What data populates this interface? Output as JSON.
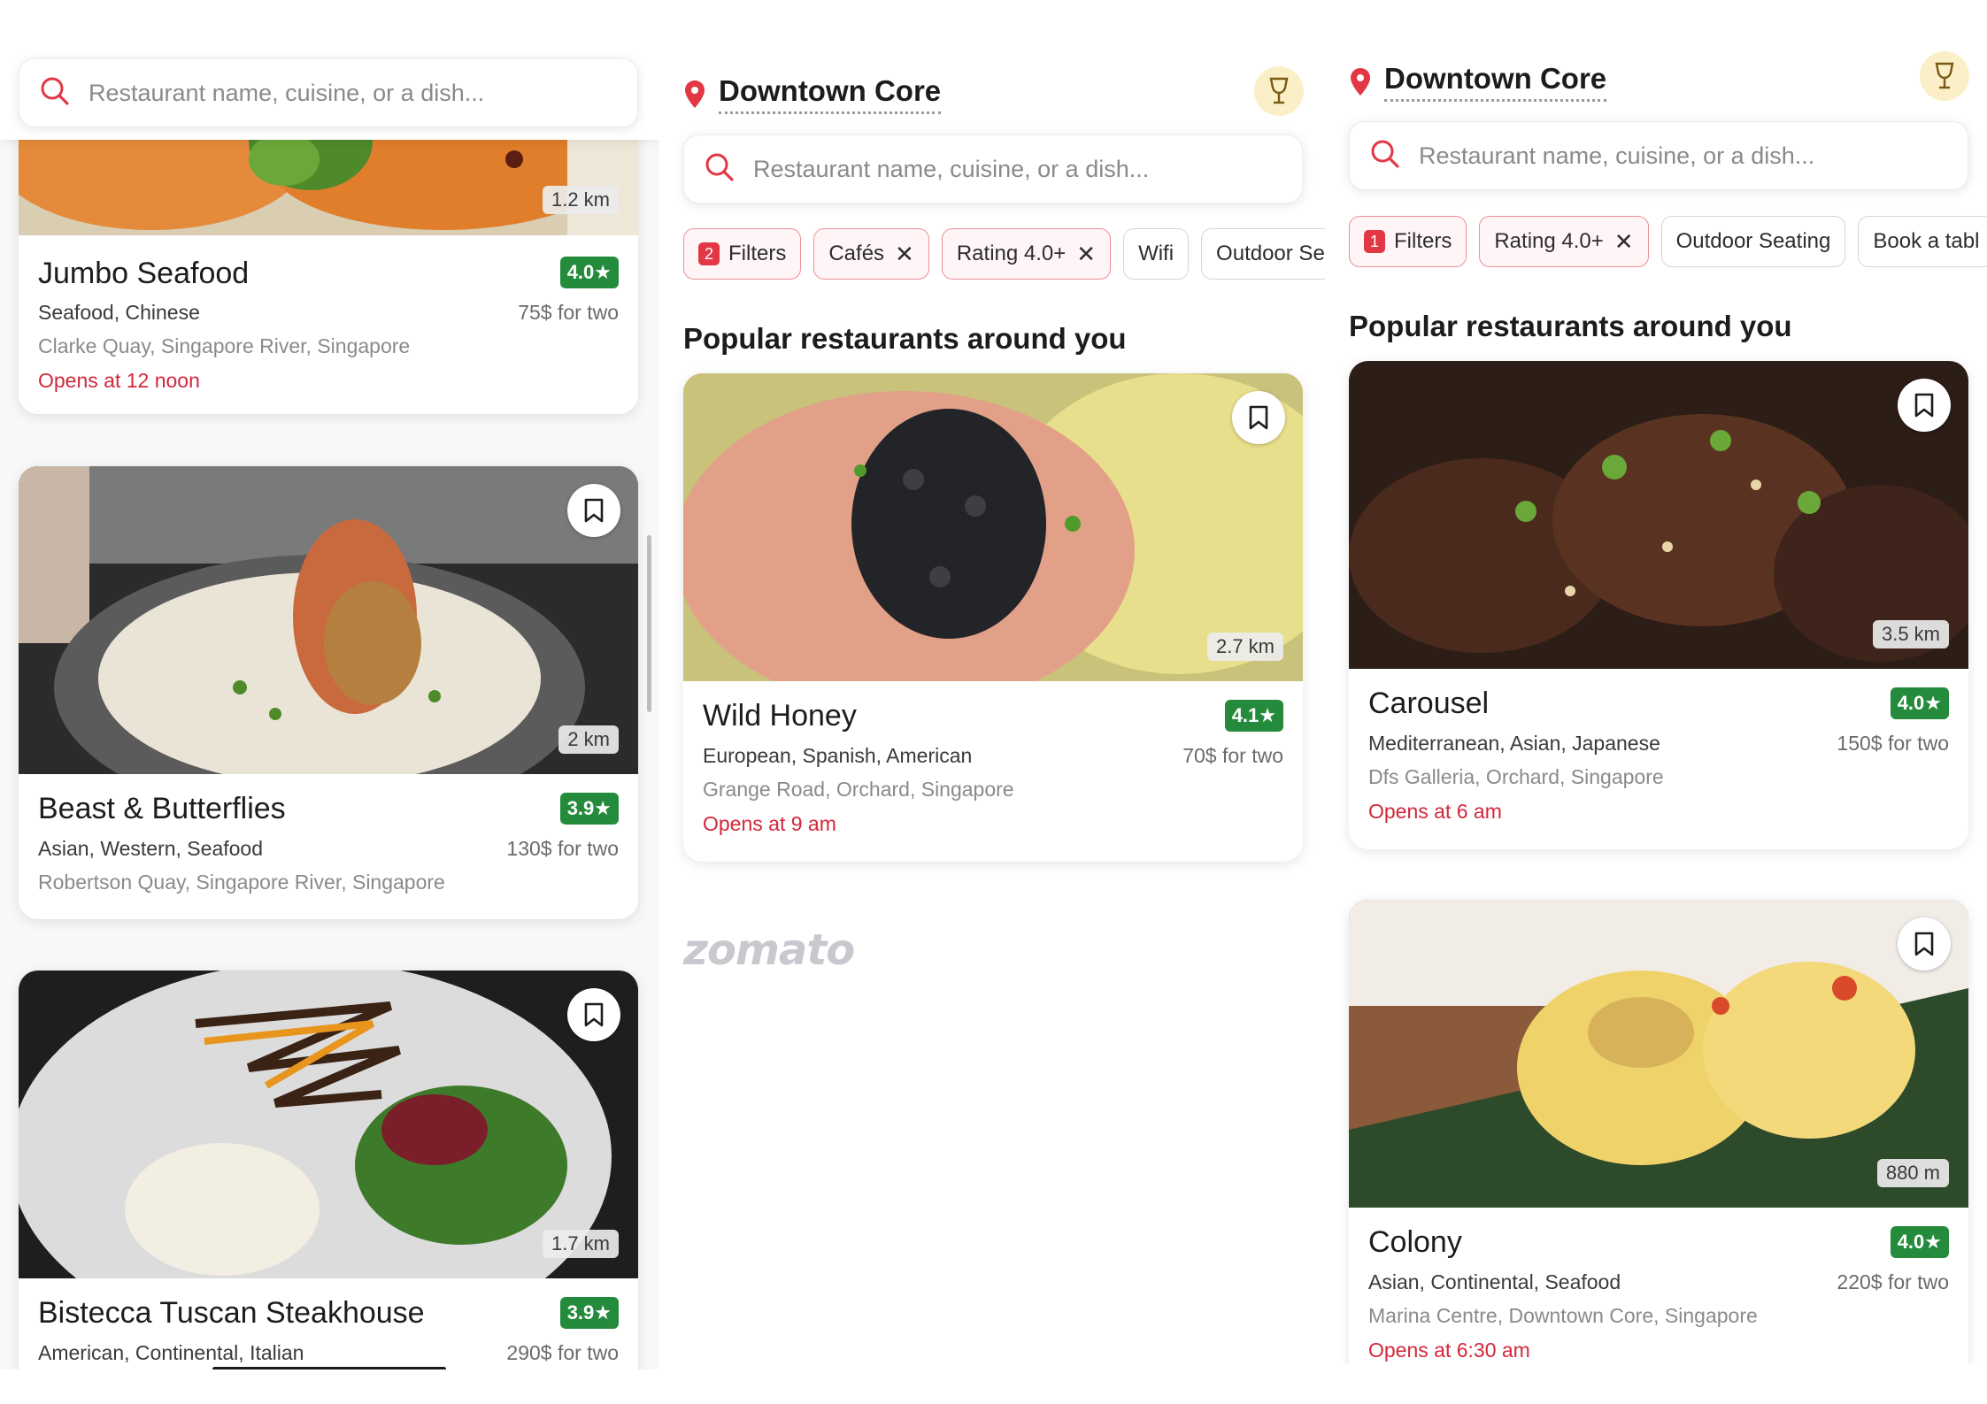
{
  "search": {
    "placeholder": "Restaurant name, cuisine, or a dish..."
  },
  "location": {
    "name": "Downtown Core"
  },
  "section_title": "Popular restaurants around you",
  "brand": "zomato",
  "colors": {
    "accent": "#e23744",
    "rating": "#258b3c",
    "opens": "#d3273b"
  },
  "panel1": {
    "cards": [
      {
        "name": "Jumbo Seafood",
        "rating": "4.0★",
        "cuisine": "Seafood, Chinese",
        "price": "75$ for two",
        "address": "Clarke Quay, Singapore River, Singapore",
        "opens": "Opens at 12 noon",
        "distance": "1.2 km"
      },
      {
        "name": "Beast & Butterflies",
        "rating": "3.9★",
        "cuisine": "Asian, Western, Seafood",
        "price": "130$ for two",
        "address": "Robertson Quay, Singapore River, Singapore",
        "distance": "2 km"
      },
      {
        "name": "Bistecca Tuscan Steakhouse",
        "rating": "3.9★",
        "cuisine": "American, Continental, Italian",
        "price": "290$ for two",
        "distance": "1.7 km"
      }
    ]
  },
  "panel2": {
    "chips": [
      {
        "count": "2",
        "label": "Filters"
      },
      {
        "label": "Cafés",
        "removable": "✕"
      },
      {
        "label": "Rating 4.0+",
        "removable": "✕"
      },
      {
        "label": "Wifi"
      },
      {
        "label": "Outdoor Sea"
      }
    ],
    "card": {
      "name": "Wild Honey",
      "rating": "4.1★",
      "cuisine": "European, Spanish, American",
      "price": "70$ for two",
      "address": "Grange Road, Orchard, Singapore",
      "opens": "Opens at 9 am",
      "distance": "2.7 km"
    }
  },
  "panel3": {
    "chips": [
      {
        "count": "1",
        "label": "Filters"
      },
      {
        "label": "Rating 4.0+",
        "removable": "✕"
      },
      {
        "label": "Outdoor Seating"
      },
      {
        "label": "Book a tabl"
      }
    ],
    "cards": [
      {
        "name": "Carousel",
        "rating": "4.0★",
        "cuisine": "Mediterranean, Asian, Japanese",
        "price": "150$ for two",
        "address": "Dfs Galleria, Orchard, Singapore",
        "opens": "Opens at 6 am",
        "distance": "3.5 km"
      },
      {
        "name": "Colony",
        "rating": "4.0★",
        "cuisine": "Asian, Continental, Seafood",
        "price": "220$ for two",
        "address": "Marina Centre, Downtown Core, Singapore",
        "opens": "Opens at 6:30 am",
        "distance": "880 m"
      }
    ]
  }
}
